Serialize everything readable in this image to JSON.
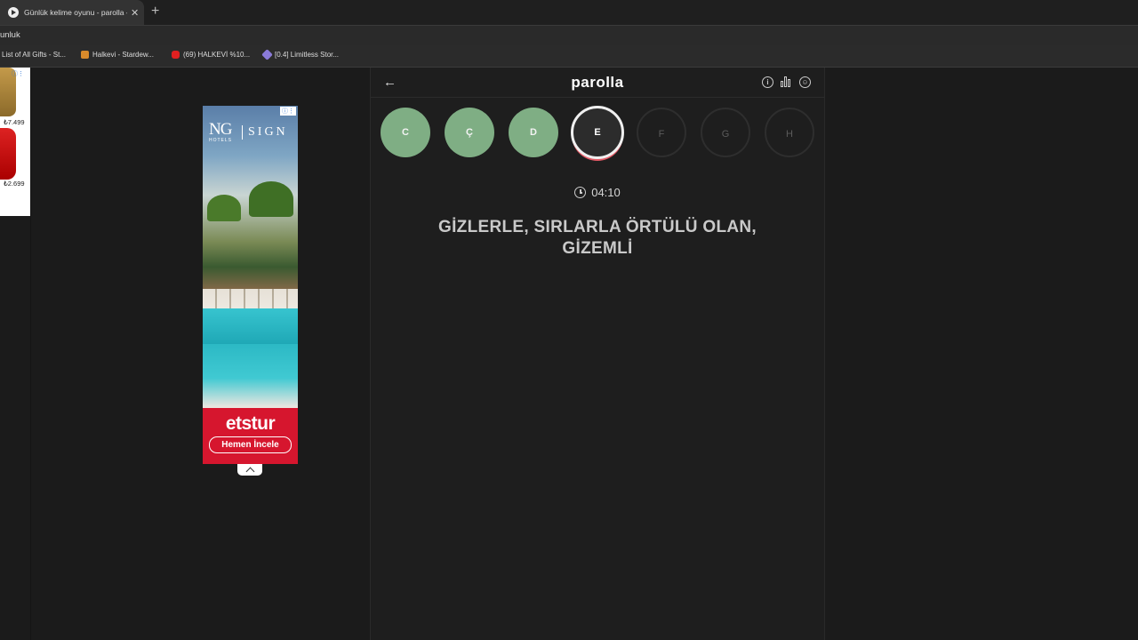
{
  "browser": {
    "tab_title": "Günlük kelime oyunu - parolla - K",
    "address_text": "unluk",
    "bookmarks": [
      {
        "label": "List of All Gifts - St...",
        "color": "#2b2b2b"
      },
      {
        "label": "Halkevi - Stardew...",
        "color": "#d98a2b"
      },
      {
        "label": "(69) HALKEVİ %10...",
        "color": "#e02020"
      },
      {
        "label": "[0.4] Limitless Stor...",
        "color": "#8a7ad8"
      }
    ]
  },
  "left_ad": {
    "price1": "₺7.499",
    "price2": "₺2.699"
  },
  "ad": {
    "logo": "NG",
    "logo_sub": "HOTELS",
    "sign": "SIGN",
    "brand": "etstur",
    "cta": "Hemen İncele"
  },
  "game": {
    "logo": "parolla",
    "back_icon": "←",
    "letters": [
      {
        "char": "C",
        "state": "done"
      },
      {
        "char": "Ç",
        "state": "done"
      },
      {
        "char": "D",
        "state": "done"
      },
      {
        "char": "E",
        "state": "current"
      },
      {
        "char": "F",
        "state": "future"
      },
      {
        "char": "G",
        "state": "future"
      },
      {
        "char": "H",
        "state": "future"
      }
    ],
    "timer": "04:10",
    "clue": "GİZLERLE, SIRLARLA ÖRTÜLÜ OLAN, GİZEMLİ"
  },
  "colors": {
    "done": "#7fae84",
    "current_border": "#f0f0f0",
    "current_underline": "#e35a66"
  }
}
